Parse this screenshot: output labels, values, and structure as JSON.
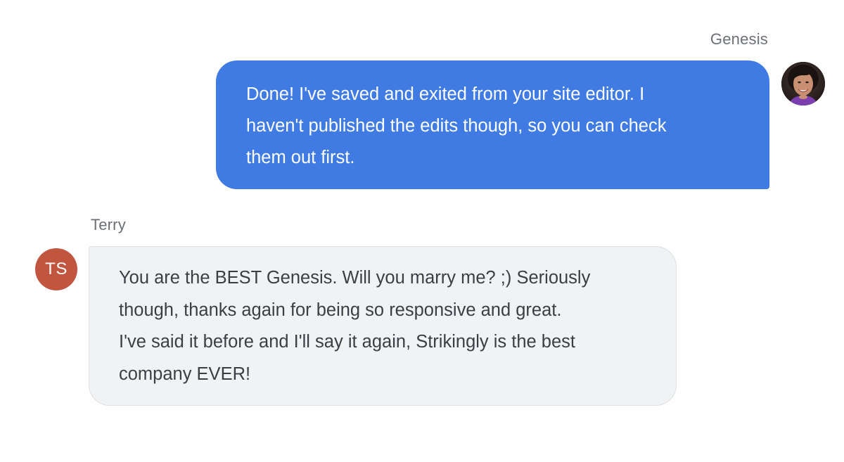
{
  "messages": {
    "outgoing": {
      "sender": "Genesis",
      "lines": [
        "Done! I've saved and exited from your site editor. I",
        "haven't published the edits though, so you can check",
        "them out first."
      ]
    },
    "incoming": {
      "sender": "Terry",
      "initials": "TS",
      "lines": [
        "You are the BEST Genesis. Will you marry me? ;) Seriously",
        "though, thanks again for being so responsive and great.",
        "I've said it before and I'll say it again, Strikingly is the best",
        "company EVER!"
      ]
    }
  },
  "colors": {
    "outgoing_bubble": "#3f7be3",
    "incoming_bubble": "#f1f2f4",
    "initials_avatar": "#c2553f"
  },
  "icons": {
    "agent_avatar": "agent-avatar-photo"
  }
}
